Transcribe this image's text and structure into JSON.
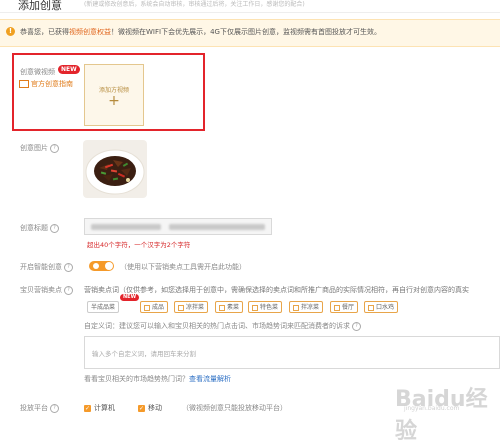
{
  "header": {
    "title": "添加创意",
    "note": "(新建或修改创意后，系统会自动审核，审核通过后将，关注工作日，感谢您的配合)"
  },
  "banner": {
    "prefix": "恭喜您，已获得",
    "highlight": "视频创意权益",
    "suffix": "！微视频在WIFI下会优先展示，4G下仅展示图片创意，监视频需有首图投放才可生效。"
  },
  "video_section": {
    "label": "创意微视频",
    "new_badge": "NEW",
    "guide_link": "官方创意指南",
    "upload_label": "添加方视频",
    "upload_plus": "+"
  },
  "image_section": {
    "label": "创意图片",
    "help": "?"
  },
  "title_section": {
    "label": "创意标题",
    "help": "?",
    "error": "超出40个字符，一个汉字为2个字符"
  },
  "smart_creative": {
    "label": "开启智能创意",
    "help": "?",
    "note": "（使用以下营销卖点工具需开启此功能）"
  },
  "selling_points": {
    "label": "宝贝营销卖点",
    "help": "?",
    "hint": "营销卖点词（仅供参考，如您选择用于创意中，需确保选择的卖点词和所推广商品的实际情况相符，再自行对创意内容的真实",
    "new_badge": "NEW",
    "tags": [
      "半成品菜",
      "成品",
      "凉拌菜",
      "素菜",
      "特色菜",
      "拌凉菜",
      "餐厅",
      "口水鸡"
    ]
  },
  "custom_words": {
    "prefix": "自定义词：建议您可以输入和宝贝相关的热门点击词、市场趋势词来匹配消费者的诉求",
    "help": "?",
    "placeholder": "输入多个自定义词，请用回车来分割",
    "trend_prefix": "看看宝贝相关的市场趋势热门词？",
    "trend_link": "查看流量解析"
  },
  "platform": {
    "label": "投放平台",
    "help": "?",
    "options": [
      "计算机",
      "移动"
    ],
    "note": "（微视频创意只能投放移动平台）"
  },
  "watermark": {
    "logo": "Baidu经验",
    "url": "jingyan.baidu.com"
  },
  "colors": {
    "accent": "#f59a2a",
    "alert_border": "#e3242b",
    "error_text": "#d62728",
    "banner_bg": "#fff7e6"
  }
}
